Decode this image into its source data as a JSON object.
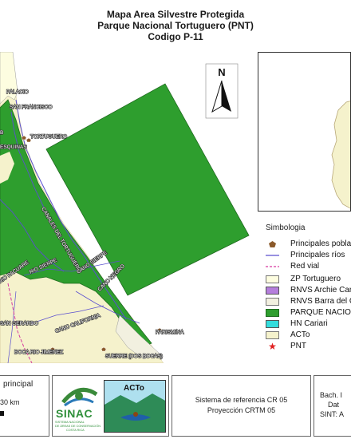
{
  "header": {
    "line1": "Mapa Area Silvestre Protegida",
    "line2": "Parque Nacional Tortuguero (PNT)",
    "line3": "Codigo P-11"
  },
  "map": {
    "north_label": "N",
    "places": {
      "palacio": "PALACIO",
      "san_francisco": "SAN FRANCISCO",
      "tortuguero": "TORTUGUERO",
      "cuatro_esquinas": "CUATRO ESQUINAS",
      "esquinas_partial": "ESQUINAS",
      "fragment": "B",
      "canales": "CANALES DEL TORTUGUERO",
      "rio_sierpe": "RIO SIERPE",
      "cano_sierpe": "CANO SIERPE",
      "cano_negro": "CANO NEGRO",
      "rio_pacuare": "RIO PACUARE",
      "san_gerardo": "SAN GERARDO",
      "cano_california": "CANO CALIFORNIA",
      "parismina": "PARISMINA",
      "boca_rio_jimenez": "BOCA RIO JIMENEZ",
      "suerre": "SUERRE (DOS BOCAS)"
    }
  },
  "legend": {
    "title": "Simbologia",
    "items": [
      {
        "label": "Principales poblados",
        "symbol": "pentagon",
        "color": "#8B5A2B"
      },
      {
        "label": "Principales ríos",
        "symbol": "line",
        "color": "#5a4fcf"
      },
      {
        "label": "Red vial",
        "symbol": "dashed",
        "color": "#d63aa0"
      },
      {
        "label": "ZP Tortuguero",
        "symbol": "box",
        "color": "#fdfde0"
      },
      {
        "label": "RNVS Archie Carr",
        "symbol": "box",
        "color": "#b57edc"
      },
      {
        "label": "RNVS Barra del Colorado",
        "symbol": "box",
        "color": "#f2f0e0"
      },
      {
        "label": "PARQUE NACIONAL",
        "symbol": "box",
        "color": "#2e9e2e"
      },
      {
        "label": "HN Cariari",
        "symbol": "box",
        "color": "#33dddd"
      },
      {
        "label": "ACTo",
        "symbol": "box",
        "color": "#f5f2cc"
      },
      {
        "label": "PNT",
        "symbol": "star",
        "color": "#e02020"
      }
    ]
  },
  "footer": {
    "scale_title": "principal",
    "scale_value": "30 km",
    "sinac_text": "SINAC",
    "sinac_sub1": "SISTEMA NACIONAL",
    "sinac_sub2": "DE ÁREAS DE CONSERVACIÓN",
    "sinac_sub3": "COSTA RICA",
    "acto_text": "ACTo",
    "reference_line1": "Sistema de referencia CR 05",
    "reference_line2": "Proyección CRTM 05",
    "author_line1": "Bach. I",
    "author_line2": "Dat",
    "author_line3": "SINT: A"
  }
}
